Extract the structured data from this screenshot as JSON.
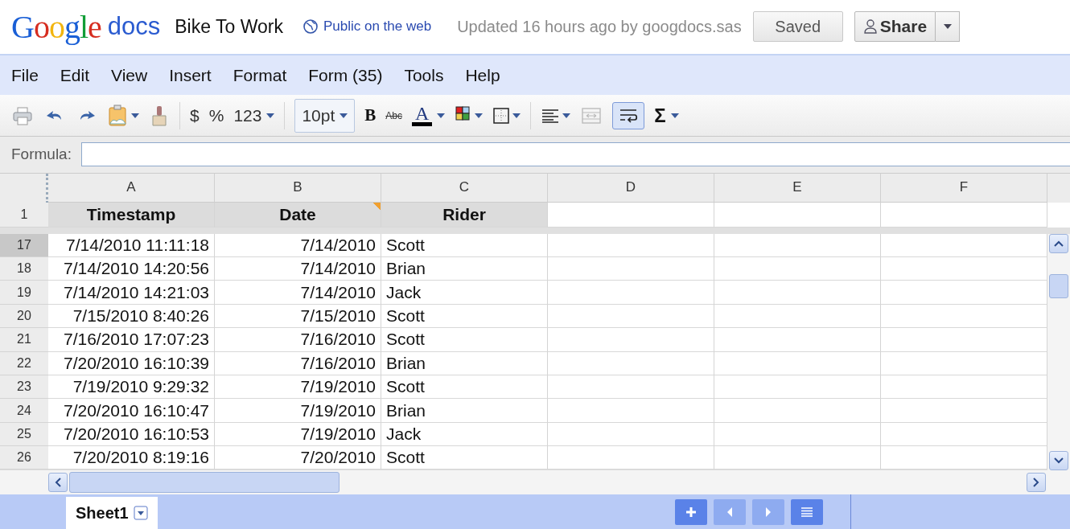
{
  "header": {
    "logo": "Google",
    "product": "docs",
    "doc_title": "Bike To Work",
    "visibility": "Public on the web",
    "updated": "Updated 16 hours ago by googdocs.sas",
    "saved_button": "Saved",
    "share_button": "Share"
  },
  "menu": [
    "File",
    "Edit",
    "View",
    "Insert",
    "Format",
    "Form (35)",
    "Tools",
    "Help"
  ],
  "toolbar": {
    "currency": "$",
    "percent": "%",
    "number_format": "123",
    "font_size": "10pt",
    "bold": "B",
    "strikethrough": "Abc",
    "text_color": "A",
    "sum": "Σ",
    "merge_disabled": true,
    "wrap_selected": true
  },
  "formula": {
    "label": "Formula:"
  },
  "columns": [
    "A",
    "B",
    "C",
    "D",
    "E",
    "F"
  ],
  "header_row": {
    "number": "1",
    "cells": [
      {
        "text": "Timestamp",
        "note": false
      },
      {
        "text": "Date",
        "note": true
      },
      {
        "text": "Rider",
        "note": false
      }
    ]
  },
  "rows": [
    {
      "number": "17",
      "selected": true,
      "timestamp": "7/14/2010 11:11:18",
      "date": "7/14/2010",
      "rider": "Scott"
    },
    {
      "number": "18",
      "selected": false,
      "timestamp": "7/14/2010 14:20:56",
      "date": "7/14/2010",
      "rider": "Brian"
    },
    {
      "number": "19",
      "selected": false,
      "timestamp": "7/14/2010 14:21:03",
      "date": "7/14/2010",
      "rider": "Jack"
    },
    {
      "number": "20",
      "selected": false,
      "timestamp": "7/15/2010 8:40:26",
      "date": "7/15/2010",
      "rider": "Scott"
    },
    {
      "number": "21",
      "selected": false,
      "timestamp": "7/16/2010 17:07:23",
      "date": "7/16/2010",
      "rider": "Scott"
    },
    {
      "number": "22",
      "selected": false,
      "timestamp": "7/20/2010 16:10:39",
      "date": "7/16/2010",
      "rider": "Brian"
    },
    {
      "number": "23",
      "selected": false,
      "timestamp": "7/19/2010 9:29:32",
      "date": "7/19/2010",
      "rider": "Scott"
    },
    {
      "number": "24",
      "selected": false,
      "timestamp": "7/20/2010 16:10:47",
      "date": "7/19/2010",
      "rider": "Brian"
    },
    {
      "number": "25",
      "selected": false,
      "timestamp": "7/20/2010 16:10:53",
      "date": "7/19/2010",
      "rider": "Jack"
    },
    {
      "number": "26",
      "selected": false,
      "timestamp": "7/20/2010 8:19:16",
      "date": "7/20/2010",
      "rider": "Scott"
    }
  ],
  "sheets": [
    {
      "name": "Sheet1",
      "selected": true
    }
  ]
}
